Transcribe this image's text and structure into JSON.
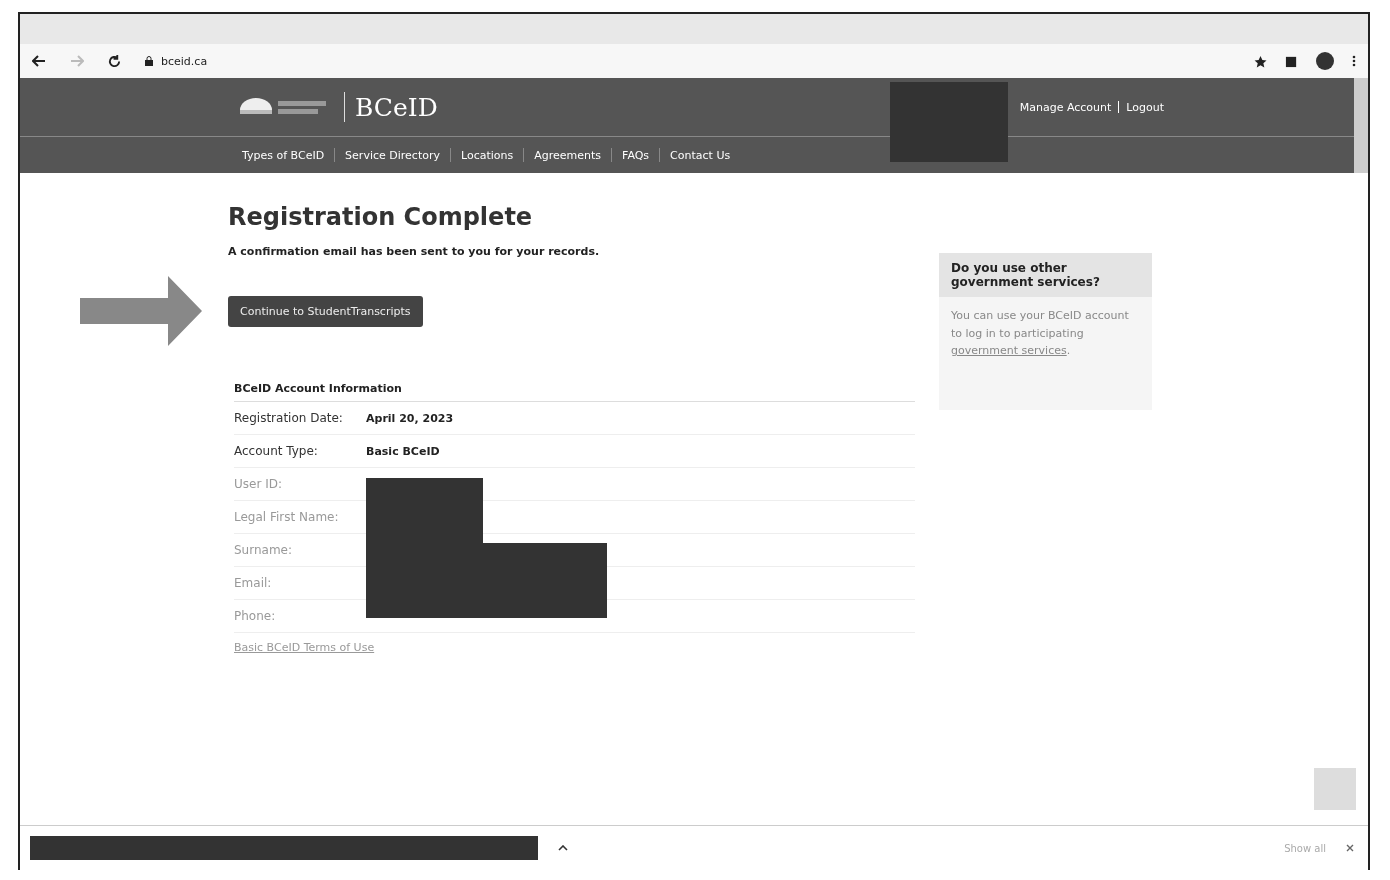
{
  "browser": {
    "address": "bceid.ca"
  },
  "site": {
    "logo_text": "BCeID",
    "account_links": [
      "Manage Account",
      "Logout"
    ],
    "nav": [
      "Types of BCeID",
      "Service Directory",
      "Locations",
      "Agreements",
      "FAQs",
      "Contact Us"
    ]
  },
  "page": {
    "title": "Registration Complete",
    "message": "A confirmation email has been sent to you for your records.",
    "continue_button": "Continue to StudentTranscripts",
    "account_info": {
      "heading": "BCeID Account Information",
      "rows": [
        {
          "label": "Registration Date:",
          "value": "April 20, 2023"
        },
        {
          "label": "Account Type:",
          "value": "Basic BCeID"
        },
        {
          "label": "User ID:"
        },
        {
          "label": "Legal First Name:"
        },
        {
          "label": "Surname:"
        },
        {
          "label": "Email:"
        },
        {
          "label": "Phone:"
        }
      ],
      "terms_link": "Basic BCeID Terms of Use"
    }
  },
  "sidebar": {
    "heading": "Do you use other government services?",
    "text": "You can use your BCeID account to log in to participating",
    "link": "government services",
    "after": "."
  },
  "download_bar": {
    "show_all": "Show all"
  }
}
